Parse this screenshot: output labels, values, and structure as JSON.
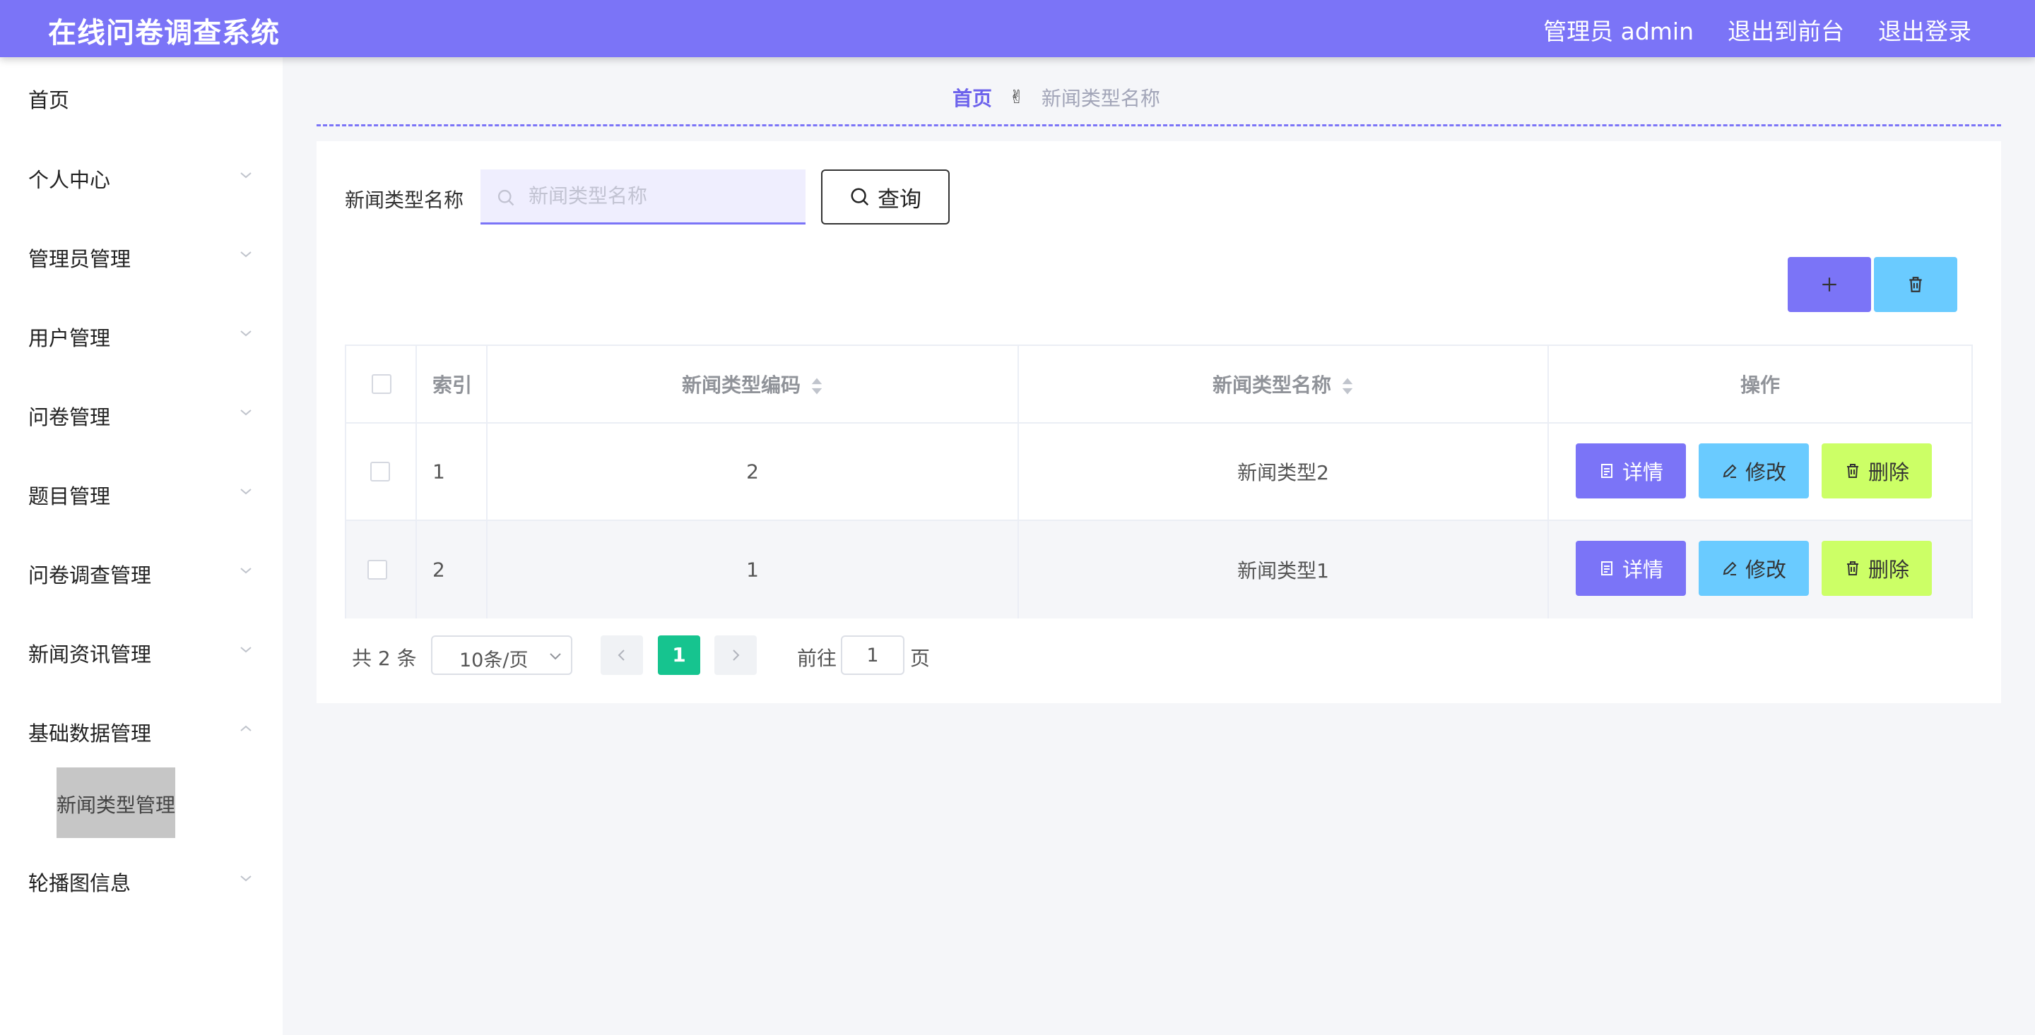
{
  "header": {
    "title": "在线问卷调查系统",
    "user_label": "管理员 admin",
    "exit_front": "退出到前台",
    "logout": "退出登录",
    "color": "#7b74f7"
  },
  "sidebar": {
    "items": [
      {
        "label": "首页",
        "has_children": false
      },
      {
        "label": "个人中心",
        "has_children": true,
        "expanded": false
      },
      {
        "label": "管理员管理",
        "has_children": true,
        "expanded": false
      },
      {
        "label": "用户管理",
        "has_children": true,
        "expanded": false
      },
      {
        "label": "问卷管理",
        "has_children": true,
        "expanded": false
      },
      {
        "label": "题目管理",
        "has_children": true,
        "expanded": false
      },
      {
        "label": "问卷调查管理",
        "has_children": true,
        "expanded": false
      },
      {
        "label": "新闻资讯管理",
        "has_children": true,
        "expanded": false
      },
      {
        "label": "基础数据管理",
        "has_children": true,
        "expanded": true
      },
      {
        "label": "轮播图信息",
        "has_children": true,
        "expanded": false
      }
    ],
    "active_sub_item": "新闻类型管理"
  },
  "breadcrumb": {
    "home": "首页",
    "separator_icon": "victory-hand-icon",
    "current": "新闻类型名称"
  },
  "search": {
    "label": "新闻类型名称",
    "placeholder": "新闻类型名称",
    "value": "",
    "button_label": "查询"
  },
  "toolbar": {
    "add_icon": "plus-icon",
    "delete_icon": "trash-icon"
  },
  "table": {
    "columns": [
      "索引",
      "新闻类型编码",
      "新闻类型名称",
      "操作"
    ],
    "rows": [
      {
        "index": "1",
        "code": "2",
        "name": "新闻类型2"
      },
      {
        "index": "2",
        "code": "1",
        "name": "新闻类型1"
      }
    ],
    "actions": {
      "detail": "详情",
      "edit": "修改",
      "delete": "删除"
    }
  },
  "pagination": {
    "total_text": "共 2 条",
    "page_size": "10条/页",
    "current_page": "1",
    "goto_label": "前往",
    "goto_value": "1",
    "page_unit": "页"
  },
  "colors": {
    "primary": "#7b74f7",
    "info": "#6acbff",
    "lime": "#ccff66",
    "pager_active": "#16c48f"
  }
}
